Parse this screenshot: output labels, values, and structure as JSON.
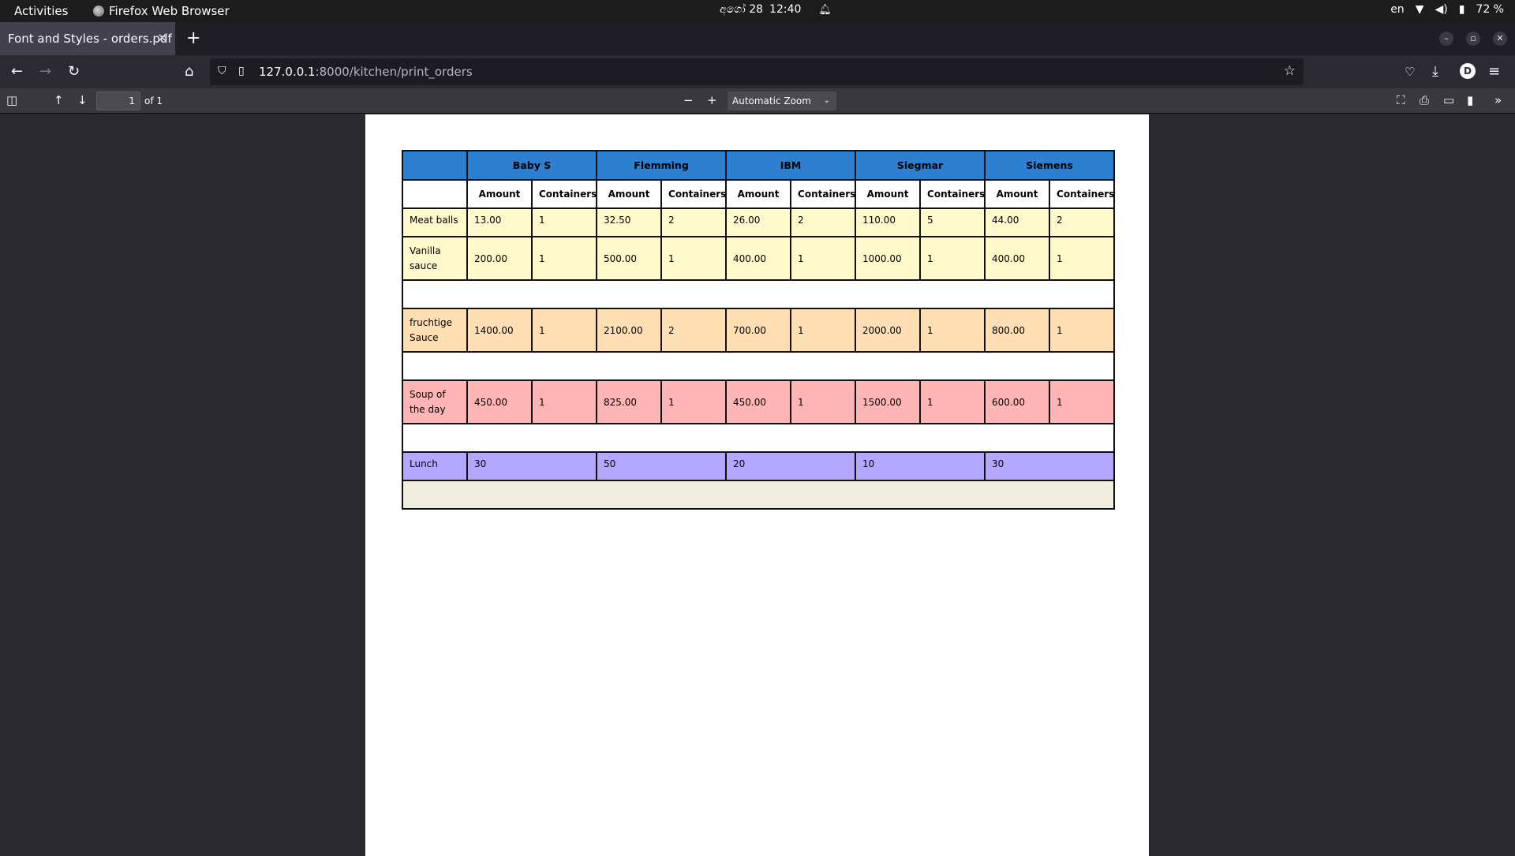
{
  "system_bar": {
    "activities": "Activities",
    "app_name": "Firefox Web Browser",
    "date": "අගෝ 28",
    "time": "12:40",
    "keyboard_layout": "en",
    "battery": "72 %"
  },
  "browser": {
    "tab_title": "Font and Styles - orders.pdf",
    "url_host": "127.0.0.1",
    "url_path": ":8000/kitchen/print_orders"
  },
  "pdf_viewer": {
    "page_number": "1",
    "page_count": "of 1",
    "zoom": "Automatic Zoom"
  },
  "orders_table": {
    "customers": [
      "Baby S",
      "Flemming",
      "IBM",
      "Siegmar",
      "Siemens"
    ],
    "amount_header": "Amount",
    "containers_header": "Containers",
    "rows": {
      "meat_balls": {
        "label": "Meat balls",
        "values": [
          [
            "13.00",
            "1"
          ],
          [
            "32.50",
            "2"
          ],
          [
            "26.00",
            "2"
          ],
          [
            "110.00",
            "5"
          ],
          [
            "44.00",
            "2"
          ]
        ]
      },
      "vanilla_sauce": {
        "label": "Vanilla sauce",
        "values": [
          [
            "200.00",
            "1"
          ],
          [
            "500.00",
            "1"
          ],
          [
            "400.00",
            "1"
          ],
          [
            "1000.00",
            "1"
          ],
          [
            "400.00",
            "1"
          ]
        ]
      },
      "fruchtige_sauce": {
        "label": "fruchtige Sauce",
        "values": [
          [
            "1400.00",
            "1"
          ],
          [
            "2100.00",
            "2"
          ],
          [
            "700.00",
            "1"
          ],
          [
            "2000.00",
            "1"
          ],
          [
            "800.00",
            "1"
          ]
        ]
      },
      "soup": {
        "label": "Soup of the day",
        "values": [
          [
            "450.00",
            "1"
          ],
          [
            "825.00",
            "1"
          ],
          [
            "450.00",
            "1"
          ],
          [
            "1500.00",
            "1"
          ],
          [
            "600.00",
            "1"
          ]
        ]
      },
      "lunch": {
        "label": "Lunch",
        "values": [
          "30",
          "50",
          "20",
          "10",
          "30"
        ]
      }
    }
  },
  "colors": {
    "header_blue": "#2f7fd1",
    "yellow_row": "#fff9cc",
    "orange_row": "#ffdfb3",
    "pink_row": "#ffb5b5",
    "purple_row": "#b4a7ff",
    "beige_row": "#f2eedf"
  }
}
